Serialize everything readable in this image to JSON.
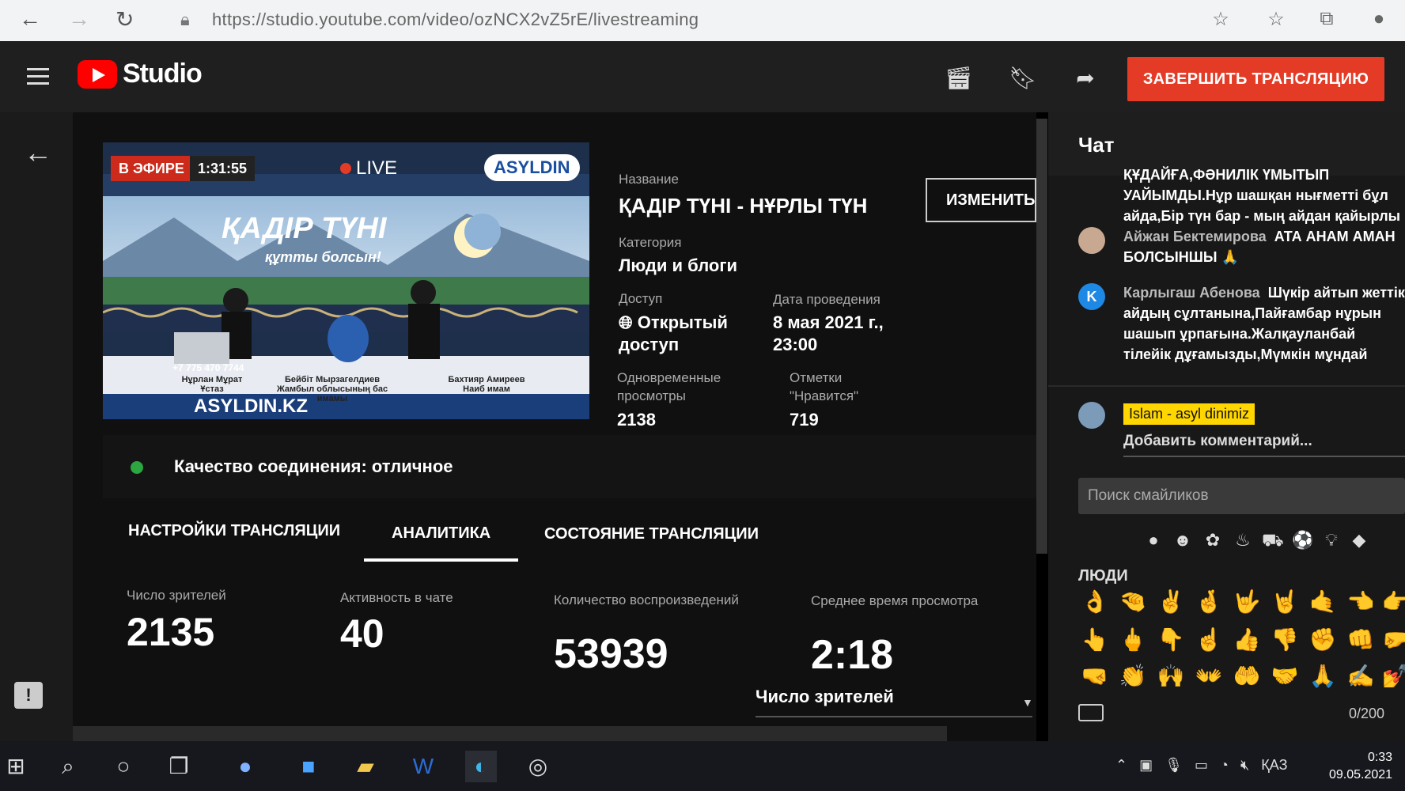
{
  "browser": {
    "url": "https://studio.youtube.com/video/ozNCX2vZ5rE/livestreaming"
  },
  "header": {
    "logo_text": "Studio",
    "end_button": "ЗАВЕРШИТЬ ТРАНСЛЯЦИЮ"
  },
  "preview": {
    "on_air": "В ЭФИРЕ",
    "timer": "1:31:55",
    "live": "LIVE",
    "channel_logo": "ASYLDIN",
    "title_art": "ҚАДІР ТҮНІ",
    "subtitle_art": "құтты болсын!",
    "phone": "+7 775 470 7744",
    "guest1_name": "Нұрлан Мұрат",
    "guest1_role": "Ұстаз",
    "guest2_name": "Бейбіт Мырзагелдиев",
    "guest2_role": "Жамбыл облысының бас имамы",
    "guest3_name": "Бахтияр Амиреев",
    "guest3_role": "Наиб имам",
    "bottom_text": "ASYLDIN.KZ"
  },
  "details": {
    "title_label": "Название",
    "title_value": "ҚАДІР ТҮНІ - НҰРЛЫ ТҮН",
    "edit_button": "ИЗМЕНИТЬ",
    "category_label": "Категория",
    "category_value": "Люди и блоги",
    "access_label": "Доступ",
    "access_value_line1": "Открытый",
    "access_value_line2": "доступ",
    "date_label": "Дата проведения",
    "date_value_line1": "8 мая 2021 г.,",
    "date_value_line2": "23:00",
    "concurrent_label_line1": "Одновременные",
    "concurrent_label_line2": "просмотры",
    "concurrent_value": "2138",
    "likes_label_line1": "Отметки",
    "likes_label_line2": "\"Нравится\"",
    "likes_value": "719"
  },
  "quality": {
    "text": "Качество соединения: отличное",
    "color": "#2ba640"
  },
  "tabs": [
    {
      "label": "НАСТРОЙКИ ТРАНСЛЯЦИИ"
    },
    {
      "label": "АНАЛИТИКА"
    },
    {
      "label": "СОСТОЯНИЕ ТРАНСЛЯЦИИ"
    }
  ],
  "metrics": {
    "viewers_label": "Число зрителей",
    "viewers_value": "2135",
    "chat_label": "Активность в чате",
    "chat_value": "40",
    "plays_label": "Количество воспроизведений",
    "plays_value": "53939",
    "avg_label": "Среднее время просмотра",
    "avg_value": "2:18",
    "dropdown_value": "Число зрителей"
  },
  "chat": {
    "title": "Чат",
    "msg0_text": "ҚҰДАЙҒА,ФӘНИЛІК ҮМЫТЫП УАЙЫМДЫ.Нұр шашқан нығметті бұл айда,Бір түн бар - мың айдан қайырлы",
    "msg1_author": "Айжан Бектемирова",
    "msg1_text": "АТА АНАМ АМАН БОЛСЫНШЫ 🙏",
    "msg2_avatar": "K",
    "msg2_author": "Карлыгаш Абенова",
    "msg2_text": "Шүкір айтып жеттік айдың сұлтанына,Пайғамбар нұрын шашып ұрпағына.Жалқауланбай тілейік дұғамызды,Мүмкін мұндай туылмас күн тағы да.",
    "channel_tag": "Islam - asyl dinimiz",
    "add_comment": "Добавить комментарий...",
    "search_placeholder": "Поиск смайликов",
    "people_label": "ЛЮДИ",
    "counter": "0/200"
  },
  "taskbar": {
    "lang": "ҚАЗ",
    "time": "0:33",
    "date": "09.05.2021"
  },
  "colors": {
    "accent": "#e43b26",
    "youtube_red": "#ff0000",
    "tag_yellow": "#ffd600"
  }
}
